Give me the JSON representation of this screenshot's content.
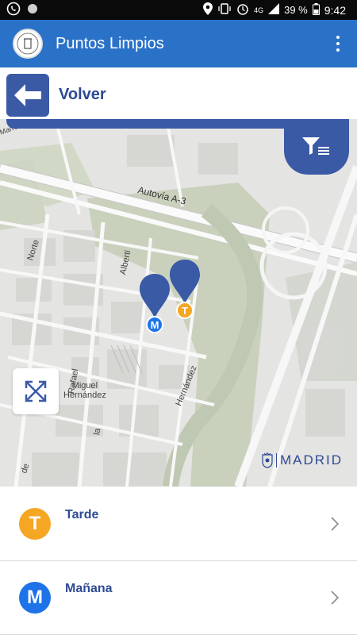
{
  "status_bar": {
    "network": "4G",
    "battery": "39 %",
    "time": "9:42"
  },
  "app_bar": {
    "title": "Puntos Limpios"
  },
  "back_bar": {
    "label": "Volver"
  },
  "map": {
    "labels": {
      "autovia": "Autovía A-3",
      "norte": "Norte",
      "alberti": "Alberti",
      "rafael": "Rafael",
      "hernandez": "Hernández",
      "miguel_hernandez": "Miguel\nHernández",
      "la": "la",
      "de": "de",
      "marron": "Marrón"
    },
    "watermark": "MADRID",
    "markers": [
      {
        "letter": "M",
        "color": "#1e73e8"
      },
      {
        "letter": "T",
        "color": "#f5a623"
      }
    ]
  },
  "list": [
    {
      "letter": "T",
      "label": "Tarde",
      "color": "#f5a623"
    },
    {
      "letter": "M",
      "label": "Mañana",
      "color": "#1e73e8"
    }
  ],
  "colors": {
    "primary": "#2a72c8",
    "accent": "#3b5aa6",
    "label": "#2d4a93"
  }
}
